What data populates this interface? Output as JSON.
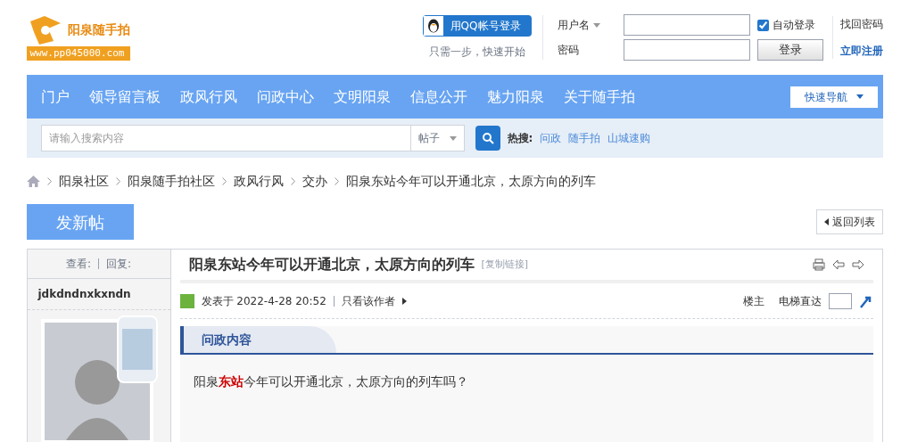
{
  "logo": {
    "name": "阳泉随手拍",
    "url": "www.pp045000.com"
  },
  "qq_login": {
    "button": "用QQ帐号登录",
    "hint": "只需一步，快速开始"
  },
  "login": {
    "username_label": "用户名",
    "password_label": "密码",
    "auto_login": {
      "label": "自动登录",
      "checked": true
    },
    "submit": "登录",
    "forgot": "找回密码",
    "register": "立即注册"
  },
  "nav": {
    "items": [
      "门户",
      "领导留言板",
      "政风行风",
      "问政中心",
      "文明阳泉",
      "信息公开",
      "魅力阳泉",
      "关于随手拍"
    ],
    "quick_nav": "快速导航"
  },
  "search": {
    "placeholder": "请输入搜索内容",
    "scope": "帖子",
    "hot_label": "热搜:",
    "hot": [
      "问政",
      "随手拍",
      "山城速购"
    ]
  },
  "breadcrumb": [
    "阳泉社区",
    "阳泉随手拍社区",
    "政风行风",
    "交办",
    "阳泉东站今年可以开通北京，太原方向的列车"
  ],
  "new_post": "发新帖",
  "back_to_list": "返回列表",
  "thread": {
    "stats": [
      "查看:",
      "回复:"
    ],
    "title": "阳泉东站今年可以开通北京，太原方向的列车",
    "copy_link": "[复制链接]",
    "author": "jdkdndnxkxndn",
    "posted": "发表于 2022-4-28 20:52",
    "only_author": "只看该作者",
    "floor": "楼主",
    "jump_label": "电梯直达",
    "section_tab": "问政内容",
    "body": "阳泉**东站**今年可以开通北京，太原方向的列车吗？"
  }
}
